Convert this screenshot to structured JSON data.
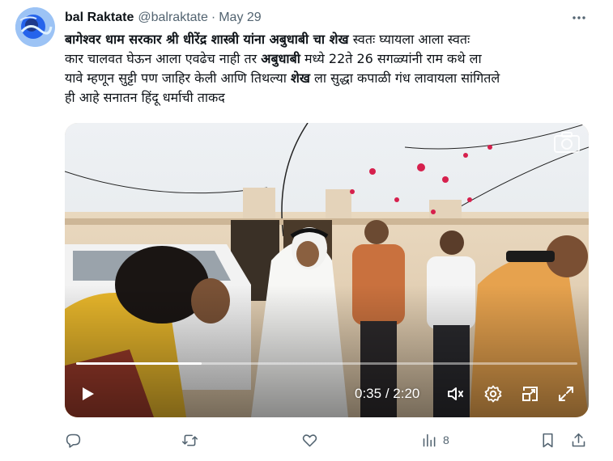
{
  "author": {
    "name": "bal Raktate",
    "handle": "@balraktate",
    "separator": "·",
    "date": "May 29"
  },
  "tweet": {
    "line1_bold": "बागेश्वर धाम सरकार श्री धीरेंद्र शास्त्री यांना अबुधाबी चा शेख",
    "line1_rest": " स्वतः घ्यायला आला स्वतः",
    "line2_pre": "कार चालवत घेऊन आला एवढेच नाही तर ",
    "line2_bold": "अबुधाबी",
    "line2_rest": " मध्ये 22ते 26 सगळ्यांनी राम कथे ला",
    "line3_pre": "यावे म्हणून सुट्टी पण जाहिर केली आणि तिथल्या ",
    "line3_bold": "शेख",
    "line3_rest": " ला सुद्धा कपाळी गंध लावायला सांगितले",
    "line4": "ही आहे सनातन हिंदू  धर्माची ताकद"
  },
  "video": {
    "current_time": "0:35",
    "time_separator": " / ",
    "duration": "2:20",
    "progress_fraction": 0.25,
    "icons": [
      "play-icon",
      "volume-icon",
      "settings-icon",
      "pip-icon",
      "fullscreen-icon",
      "camera-icon"
    ]
  },
  "actions": {
    "views": "8",
    "icons": [
      "reply-icon",
      "retweet-icon",
      "like-icon",
      "views-icon",
      "bookmark-icon",
      "share-icon"
    ]
  },
  "colors": {
    "text": "#0f1419",
    "secondary": "#536471"
  }
}
